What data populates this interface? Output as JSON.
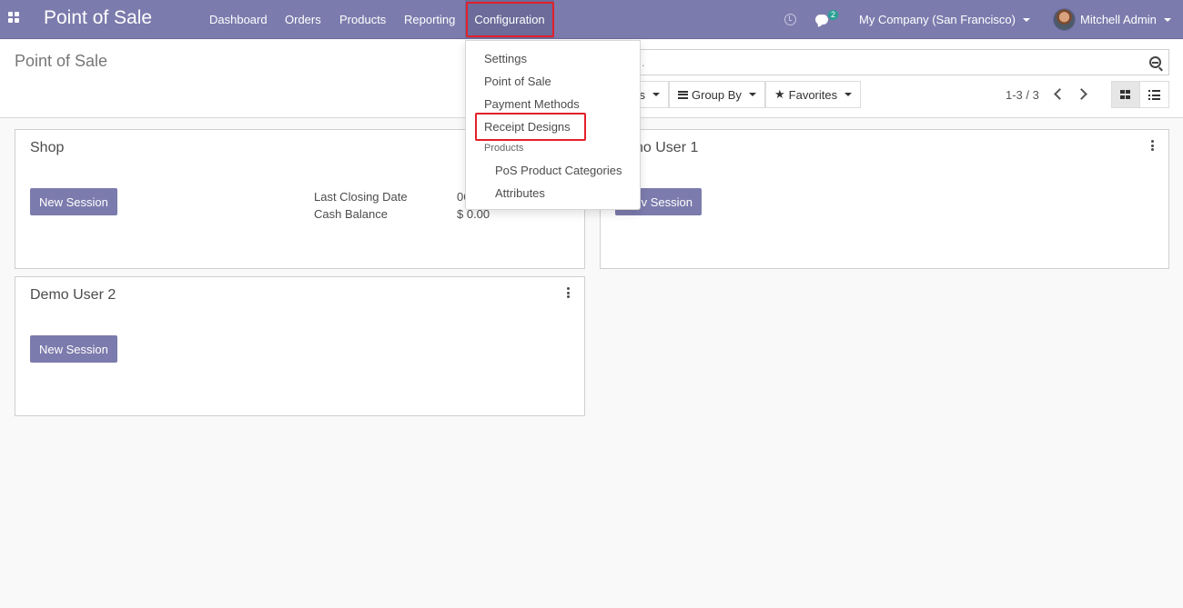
{
  "navbar": {
    "app_title": "Point of Sale",
    "menu": [
      "Dashboard",
      "Orders",
      "Products",
      "Reporting",
      "Configuration"
    ],
    "message_count": "2",
    "company": "My Company (San Francisco)",
    "user": "Mitchell Admin"
  },
  "control": {
    "breadcrumb": "Point of Sale",
    "search_placeholder": ".",
    "filters_label": "s",
    "group_by_label": "Group By",
    "favorites_label": "Favorites",
    "pager": "1-3 / 3"
  },
  "dropdown": {
    "items": [
      "Settings",
      "Point of Sale",
      "Payment Methods",
      "Receipt Designs"
    ],
    "section_header": "Products",
    "sub_items": [
      "PoS Product Categories",
      "Attributes"
    ]
  },
  "cards": [
    {
      "title": "Shop",
      "button": "New Session",
      "last_closing_label": "Last Closing Date",
      "last_closing_value": "06",
      "cash_balance_label": "Cash Balance",
      "cash_balance_value": "$ 0.00"
    },
    {
      "title": "no User 1",
      "button": "v Session"
    },
    {
      "title": "Demo User 2",
      "button": "New Session"
    }
  ],
  "colors": {
    "brand": "#7c7bad",
    "highlight": "#e3202a",
    "badge": "#28a094"
  }
}
